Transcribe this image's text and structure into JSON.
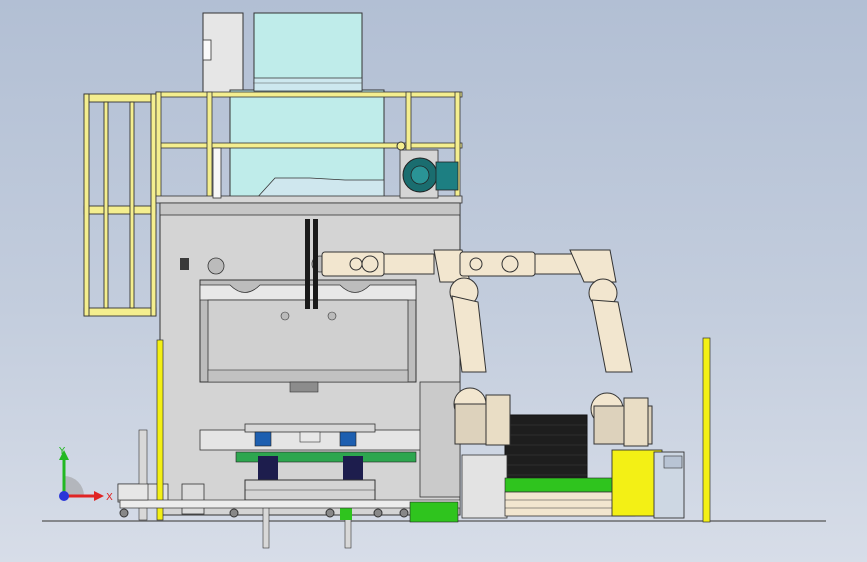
{
  "view": {
    "title": "",
    "triad": {
      "y_label": "Y",
      "x_label": "X",
      "z_label": ""
    }
  },
  "colors": {
    "background_top": "#b2bfd4",
    "background_bottom": "#d7dde8",
    "press_body": "#d4d4d4",
    "press_dark": "#a9a9a9",
    "hopper": "#bfecea",
    "railing": "#f4ee8f",
    "robot": "#f2e6cf",
    "robot_outline": "#333333",
    "motor_teal": "#1a6d6f",
    "controller_yellow": "#f3f015",
    "conveyor_dark": "#1e1e1e",
    "accent_green": "#2fc41e",
    "triad_x": "#e02424",
    "triad_y": "#22b822",
    "triad_z": "#2a36d8"
  },
  "components": [
    {
      "id": "press",
      "name": "hydraulic-press"
    },
    {
      "id": "hopper",
      "name": "hopper-tank"
    },
    {
      "id": "platform",
      "name": "top-platform-railing"
    },
    {
      "id": "ladder",
      "name": "side-ladder-cage"
    },
    {
      "id": "robot-1",
      "name": "robot-arm-left"
    },
    {
      "id": "robot-2",
      "name": "robot-arm-right"
    },
    {
      "id": "conveyor",
      "name": "belt-conveyor"
    },
    {
      "id": "controller",
      "name": "yellow-control-cabinet"
    },
    {
      "id": "cart",
      "name": "transfer-cart"
    }
  ]
}
